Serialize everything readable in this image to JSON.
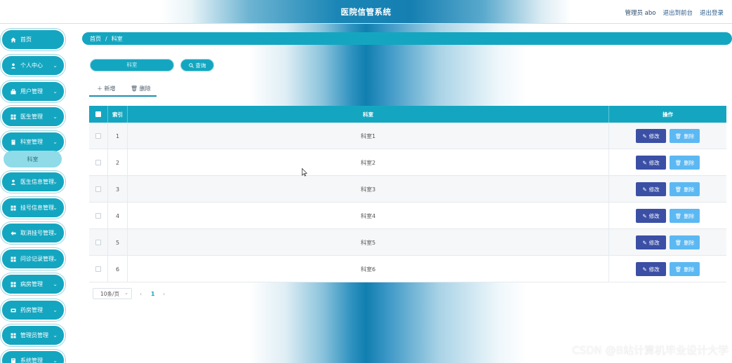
{
  "header": {
    "title": "医院信管系统",
    "user_label": "管理员 abo",
    "back_label": "退出到前台",
    "logout_label": "退出登录"
  },
  "sidebar": {
    "items": [
      {
        "label": "首页",
        "icon": "home-icon"
      },
      {
        "label": "个人中心",
        "icon": "user-icon"
      },
      {
        "label": "用户管理",
        "icon": "users-icon"
      },
      {
        "label": "医生管理",
        "icon": "grid-icon"
      },
      {
        "label": "科室管理",
        "icon": "building-icon"
      },
      {
        "label": "医生信息管理",
        "icon": "user-icon"
      },
      {
        "label": "挂号信息管理",
        "icon": "grid-icon"
      },
      {
        "label": "取消挂号管理",
        "icon": "cancel-icon"
      },
      {
        "label": "问诊记录管理",
        "icon": "grid-icon"
      },
      {
        "label": "病房管理",
        "icon": "grid-icon"
      },
      {
        "label": "药房管理",
        "icon": "pharmacy-icon"
      },
      {
        "label": "管理员管理",
        "icon": "grid-icon"
      },
      {
        "label": "系统管理",
        "icon": "settings-icon"
      }
    ],
    "active_sub": "科室"
  },
  "breadcrumb": {
    "home": "首页",
    "separator": "/",
    "current": "科室"
  },
  "search": {
    "placeholder": "科室",
    "button_label": "查询"
  },
  "actions": {
    "add_label": "新增",
    "delete_label": "删除"
  },
  "table": {
    "headers": {
      "index": "索引",
      "dept": "科室",
      "ops": "操作"
    },
    "rows": [
      {
        "index": "1",
        "dept": "科室1"
      },
      {
        "index": "2",
        "dept": "科室2"
      },
      {
        "index": "3",
        "dept": "科室3"
      },
      {
        "index": "4",
        "dept": "科室4"
      },
      {
        "index": "5",
        "dept": "科室5"
      },
      {
        "index": "6",
        "dept": "科室6"
      }
    ],
    "edit_label": "修改",
    "delete_label": "删除"
  },
  "pagination": {
    "page_size": "10条/页",
    "current_page": "1"
  },
  "watermark": "CSDN @B站计算机毕业设计大学",
  "colors": {
    "accent": "#14a6c0",
    "edit": "#3b4fa5",
    "delete": "#5cb8f2"
  }
}
